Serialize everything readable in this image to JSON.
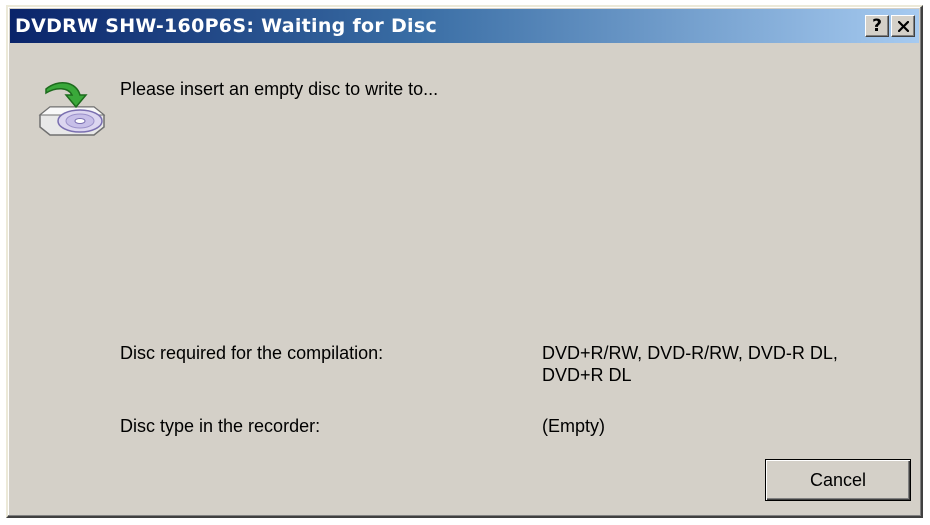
{
  "window": {
    "title": "DVDRW SHW-160P6S: Waiting for Disc",
    "help_button": "?",
    "close_button": "✕"
  },
  "icon": "disc-insert-icon",
  "message": "Please insert an empty disc to write to...",
  "info": {
    "required_label": "Disc required for the compilation:",
    "required_value_line1": "DVD+R/RW, DVD-R/RW, DVD-R DL,",
    "required_value_line2": "DVD+R DL",
    "recorder_label": "Disc type in the recorder:",
    "recorder_value": "(Empty)"
  },
  "buttons": {
    "cancel": "Cancel"
  },
  "colors": {
    "title_gradient_start": "#0a246a",
    "title_gradient_end": "#a6caf0",
    "face": "#d4d0c8"
  }
}
